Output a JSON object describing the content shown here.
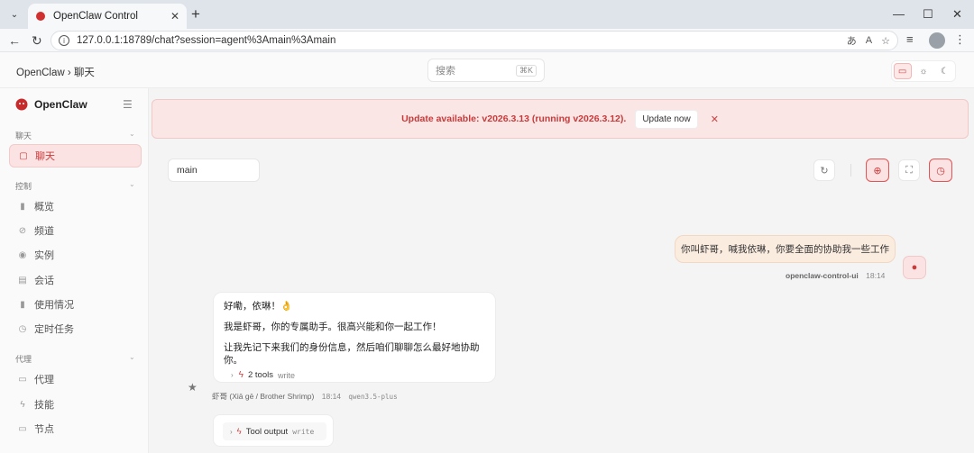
{
  "browser": {
    "tab_title": "OpenClaw Control",
    "url": "127.0.0.1:18789/chat?session=agent%3Amain%3Amain",
    "new_tab_symbol": "+",
    "tab_close_symbol": "✕",
    "min_symbol": "—",
    "max_symbol": "☐",
    "close_symbol": "✕"
  },
  "header": {
    "breadcrumb": "OpenClaw › 聊天",
    "search_placeholder": "搜索",
    "search_shortcut": "⌘K"
  },
  "sidebar": {
    "brand": "OpenClaw",
    "groups": [
      {
        "label": "聊天"
      },
      {
        "label": "控制"
      },
      {
        "label": "代理"
      }
    ],
    "items": [
      {
        "label": "聊天",
        "icon": "chat-icon",
        "glyph": "▢"
      },
      {
        "label": "概览",
        "icon": "chart-icon",
        "glyph": "▮"
      },
      {
        "label": "频道",
        "icon": "link-icon",
        "glyph": "⊘"
      },
      {
        "label": "实例",
        "icon": "broadcast-icon",
        "glyph": "◉"
      },
      {
        "label": "会话",
        "icon": "document-icon",
        "glyph": "▤"
      },
      {
        "label": "使用情况",
        "icon": "bar-chart-icon",
        "glyph": "▮"
      },
      {
        "label": "定时任务",
        "icon": "clock-icon",
        "glyph": "◷"
      },
      {
        "label": "代理",
        "icon": "folder-icon",
        "glyph": "▭"
      },
      {
        "label": "技能",
        "icon": "bolt-icon",
        "glyph": "ϟ"
      },
      {
        "label": "节点",
        "icon": "monitor-icon",
        "glyph": "▭"
      }
    ]
  },
  "banner": {
    "prefix": "Update available:",
    "text": " v2026.3.13 (running v2026.3.12).",
    "button": "Update now",
    "close": "✕"
  },
  "chat": {
    "session": "main",
    "user_message": "你叫虾哥，喊我依琳，你要全面的协助我一些工作",
    "user_sender": "openclaw-control-ui",
    "user_time": "18:14",
    "bot_lines": [
      "好嘞，依琳！👌",
      "我是虾哥，你的专属助手。很高兴能和你一起工作！",
      "让我先记下来我们的身份信息，然后咱们聊聊怎么最好地协助你。"
    ],
    "tools_label": "2 tools",
    "tools_sub": "write",
    "bot_sender": "虾哥 (Xiā gē / Brother Shrimp)",
    "bot_time": "18:14",
    "bot_model": "qwen3.5-plus",
    "tool_output_label": "Tool output",
    "tool_output_sub": "write"
  },
  "colors": {
    "accent": "#c93a3a",
    "banner_bg": "#fbe6e6",
    "user_bubble": "#fbece0"
  }
}
